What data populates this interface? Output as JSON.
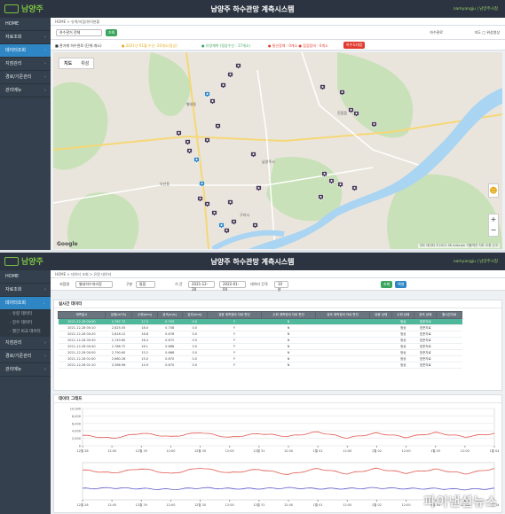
{
  "app": {
    "title": "남양주 하수관망 계측시스템",
    "logo_text": "남양주",
    "user_label": "namyangju | 남양주시청"
  },
  "sidebar": {
    "items": [
      {
        "label": "HOME"
      },
      {
        "label": "자료조회"
      },
      {
        "label": "데이터조회"
      },
      {
        "label": "지점관리"
      },
      {
        "label": "경로/기준관리"
      },
      {
        "label": "관리메뉴"
      }
    ],
    "subitems": [
      "· 유량 데이터",
      "· 강우 데이터",
      "· 월간 비교 데이터"
    ]
  },
  "top": {
    "breadcrumb": "HOME > 유역/지점/위치현황",
    "filter": {
      "select_value": "하수관거 전체",
      "search_label": "조회",
      "options_label": "하수관로",
      "checkbox_label": "지도 □ 위성영상"
    },
    "legend": [
      {
        "text": "■ 관거계 하수관로 (단위:개소)",
        "color": "#333333"
      },
      {
        "text": "● 2021년 01월 수신: 20개소(정상)",
        "color": "#e6a919"
      },
      {
        "text": "● 유량계측 (정상수신 : 17개소)",
        "color": "#3aa55d"
      },
      {
        "text": "● 통신장애 : 0개소  ● 점검장비 : 0개소",
        "color": "#e03c31"
      },
      {
        "text": "하수도대장",
        "color": "#e03c31"
      }
    ],
    "map": {
      "tab_map": "지도",
      "tab_satellite": "위성",
      "google": "Google",
      "attribution": "지도 데이터 ©2021 SK telecom  이용약관  지도 오류 신고"
    }
  },
  "bottom": {
    "breadcrumb": "HOME > 데이터 조회 > 유량 데이터",
    "filter": {
      "point_label": "지점명",
      "point_value": "별내하수처리장",
      "type_label": "구분",
      "type_value": "통합",
      "period_label": "기 간",
      "date_from": "2021-12-28",
      "date_to": "2022-01-04",
      "interval_label": "데이터 간격",
      "interval_value": "10분",
      "search_label": "조회",
      "excel_label": "엑셀"
    },
    "table": {
      "title": "실시간 데이터",
      "headers": [
        "계측일시",
        "유량(m³/h)",
        "수위(mm)",
        "유속(m/s)",
        "강우(mm)",
        "유량 계측장비 자료 판단",
        "수위 계측장비 자료 판단",
        "유속 계측장비 자료 판단",
        "유량 상태",
        "수위 상태",
        "유속 상태",
        "월시간자료"
      ],
      "rows": [
        [
          "2021-12-28 00:00",
          "2,767.72",
          "17.5",
          "0.703",
          "0.0",
          "Y",
          "N",
          "",
          "",
          "정상",
          "표준자료",
          ""
        ],
        [
          "2021-12-28 00:10",
          "2,825.55",
          "18.0",
          "0.708",
          "0.0",
          "Y",
          "N",
          "",
          "",
          "정상",
          "표준자료",
          ""
        ],
        [
          "2021-12-28 00:20",
          "2,818.12",
          "16.8",
          "0.676",
          "0.0",
          "Y",
          "N",
          "",
          "",
          "정상",
          "표준자료",
          ""
        ],
        [
          "2021-12-28 00:30",
          "2,749.60",
          "16.4",
          "0.672",
          "0.0",
          "Y",
          "N",
          "",
          "",
          "정상",
          "표준자료",
          ""
        ],
        [
          "2021-12-28 00:40",
          "2,786.72",
          "16.1",
          "0.668",
          "0.0",
          "Y",
          "N",
          "",
          "",
          "정상",
          "표준자료",
          ""
        ],
        [
          "2021-12-28 00:50",
          "2,790.60",
          "15.2",
          "0.666",
          "0.0",
          "Y",
          "N",
          "",
          "",
          "정상",
          "표준자료",
          ""
        ],
        [
          "2021-12-28 01:00",
          "2,660.28",
          "15.0",
          "0.670",
          "0.0",
          "Y",
          "N",
          "",
          "",
          "정상",
          "표준자료",
          ""
        ],
        [
          "2021-12-28 01:10",
          "2,586.96",
          "14.9",
          "0.670",
          "0.0",
          "Y",
          "N",
          "",
          "",
          "정상",
          "표준자료",
          ""
        ]
      ]
    },
    "graph_title": "데이터 그래프",
    "watermark": "파이낸셜뉴스"
  },
  "chart_data": [
    {
      "type": "line",
      "y_ticks": [
        "10,000",
        "8,000",
        "6,000",
        "4,000",
        "2,000",
        "0"
      ],
      "x_labels": [
        "12월 28",
        "12:00",
        "12월 29",
        "12:00",
        "12월 30",
        "12:00",
        "12월 31",
        "12:00",
        "1월 01",
        "12:00",
        "1월 02",
        "12:00",
        "1월 03",
        "12:00",
        "1월 04"
      ],
      "ylim": [
        0,
        10000
      ],
      "series": [
        {
          "color": "#e0564d",
          "values": [
            2800,
            2000,
            3400,
            2400,
            3600,
            2200,
            3300,
            2500,
            3700,
            2100,
            3400,
            2300,
            3500,
            2400,
            3300
          ]
        }
      ]
    },
    {
      "type": "line",
      "y_ticks": [],
      "x_labels": [
        "12월 28",
        "12:00",
        "12월 29",
        "12:00",
        "12월 30",
        "12:00",
        "12월 31",
        "12:00",
        "1월 01",
        "12:00",
        "1월 02",
        "12:00",
        "1월 03",
        "12:00",
        "1월 04"
      ],
      "series": [
        {
          "color": "#e0564d",
          "values": [
            0.7,
            0.66,
            0.72,
            0.65,
            0.73,
            0.66,
            0.71,
            0.64,
            0.72,
            0.65,
            0.72,
            0.66,
            0.71,
            0.65,
            0.72
          ]
        },
        {
          "color": "#5a55c9",
          "values": [
            0.45,
            0.46,
            0.45,
            0.44,
            0.46,
            0.45,
            0.45,
            0.46,
            0.45,
            0.45,
            0.46,
            0.45,
            0.45,
            0.44,
            0.45
          ]
        }
      ]
    }
  ],
  "colors": {
    "marker": "#4a3b55",
    "marker_active": "#2f86c5",
    "river": "#a9d4f2",
    "green": "#c8e1b8"
  }
}
